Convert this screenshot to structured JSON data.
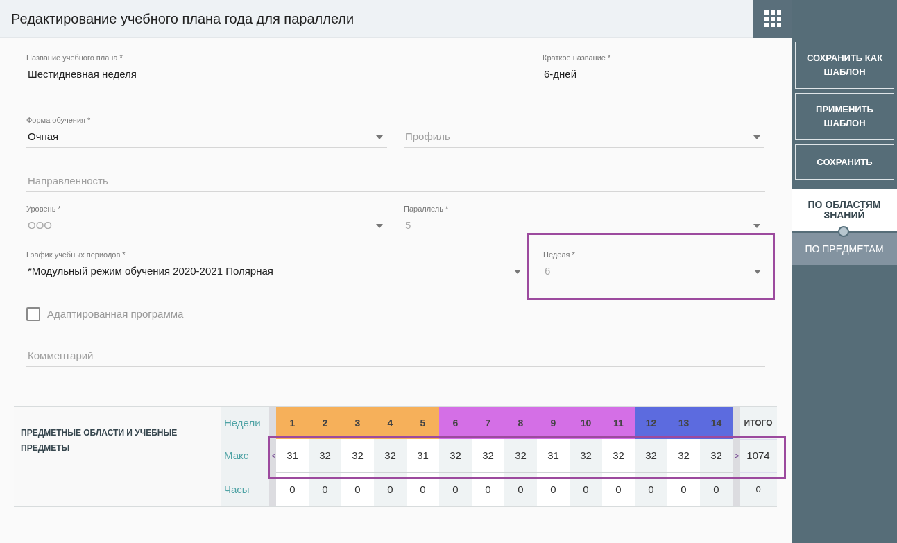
{
  "header": {
    "title": "Редактирование учебного плана года для параллели"
  },
  "form_rows": [
    {
      "fields": [
        {
          "kind": "text",
          "label": "Название учебного плана *",
          "value": "Шестидневная неделя",
          "disabled": false
        },
        {
          "kind": "text",
          "label": "Краткое название *",
          "value": "6-дней",
          "disabled": false
        }
      ]
    },
    {
      "fields": [
        {
          "kind": "select",
          "label": "Форма обучения *",
          "value": "Очная",
          "disabled": false
        },
        {
          "kind": "select",
          "placeholder": "Профиль",
          "disabled": false
        }
      ]
    },
    {
      "fields": [
        {
          "kind": "text",
          "placeholder": "Направленность",
          "disabled": false
        }
      ]
    },
    {
      "fields": [
        {
          "kind": "select",
          "label": "Уровень *",
          "value": "ООО",
          "disabled": true
        },
        {
          "kind": "select",
          "label": "Параллель *",
          "value": "5",
          "disabled": true
        }
      ]
    },
    {
      "fields": [
        {
          "kind": "select",
          "label": "График учебных периодов *",
          "value": "*Модульный режим обучения 2020-2021 Полярная",
          "disabled": false
        },
        {
          "kind": "select",
          "label": "Неделя *",
          "value": "6",
          "disabled": true,
          "highlighted": true
        }
      ]
    }
  ],
  "checkbox": {
    "label": "Адаптированная программа",
    "checked": false
  },
  "comment": {
    "placeholder": "Комментарий"
  },
  "table": {
    "title": "ПРЕДМЕТНЫЕ ОБЛАСТИ И УЧЕБНЫЕ ПРЕДМЕТЫ",
    "row_labels": [
      "Недели",
      "Макс",
      "Часы"
    ],
    "prev": "<",
    "next": ">",
    "total_header": "ИТОГО",
    "total_max": "1074",
    "total_hours": "0",
    "max_row_highlighted": true,
    "weeks": [
      {
        "number": "1",
        "color": "#f6b05a",
        "max": "31",
        "hours": "0"
      },
      {
        "number": "2",
        "color": "#f6b05a",
        "max": "32",
        "hours": "0"
      },
      {
        "number": "3",
        "color": "#f6b05a",
        "max": "32",
        "hours": "0"
      },
      {
        "number": "4",
        "color": "#f6b05a",
        "max": "32",
        "hours": "0"
      },
      {
        "number": "5",
        "color": "#f6b05a",
        "max": "31",
        "hours": "0"
      },
      {
        "number": "6",
        "color": "#d46fe6",
        "max": "32",
        "hours": "0"
      },
      {
        "number": "7",
        "color": "#d46fe6",
        "max": "32",
        "hours": "0"
      },
      {
        "number": "8",
        "color": "#d46fe6",
        "max": "32",
        "hours": "0"
      },
      {
        "number": "9",
        "color": "#d46fe6",
        "max": "31",
        "hours": "0"
      },
      {
        "number": "10",
        "color": "#d46fe6",
        "max": "32",
        "hours": "0"
      },
      {
        "number": "11",
        "color": "#d46fe6",
        "max": "32",
        "hours": "0"
      },
      {
        "number": "12",
        "color": "#5c6bdf",
        "max": "32",
        "hours": "0"
      },
      {
        "number": "13",
        "color": "#5c6bdf",
        "max": "32",
        "hours": "0"
      },
      {
        "number": "14",
        "color": "#5c6bdf",
        "max": "32",
        "hours": "0"
      }
    ]
  },
  "sidebar": {
    "buttons": [
      "СОХРАНИТЬ КАК ШАБЛОН",
      "ПРИМЕНИТЬ ШАБЛОН",
      "СОХРАНИТЬ"
    ],
    "tabs": [
      {
        "label": "ПО ОБЛАСТЯМ ЗНАНИЙ",
        "selected": true
      },
      {
        "label": "ПО ПРЕДМЕТАМ",
        "selected": false
      }
    ]
  }
}
